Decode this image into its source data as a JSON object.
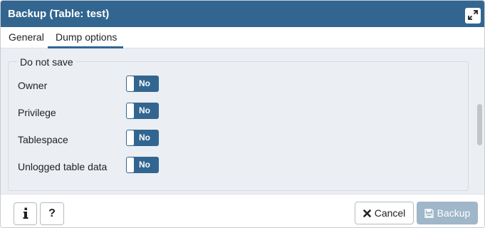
{
  "dialog": {
    "title": "Backup (Table: test)",
    "maximize_icon": "expand-arrows-icon"
  },
  "tabs": [
    {
      "label": "General",
      "active": false
    },
    {
      "label": "Dump options",
      "active": true
    }
  ],
  "section": {
    "legend": "Do not save",
    "options": [
      {
        "label": "Owner",
        "value": "No"
      },
      {
        "label": "Privilege",
        "value": "No"
      },
      {
        "label": "Tablespace",
        "value": "No"
      },
      {
        "label": "Unlogged table data",
        "value": "No"
      }
    ]
  },
  "footer": {
    "info_icon": "info-icon",
    "help_label": "?",
    "cancel_label": "Cancel",
    "backup_label": "Backup"
  },
  "colors": {
    "accent": "#326690",
    "disabled_primary": "#a0b6c9",
    "content_bg": "#ebeef3"
  }
}
